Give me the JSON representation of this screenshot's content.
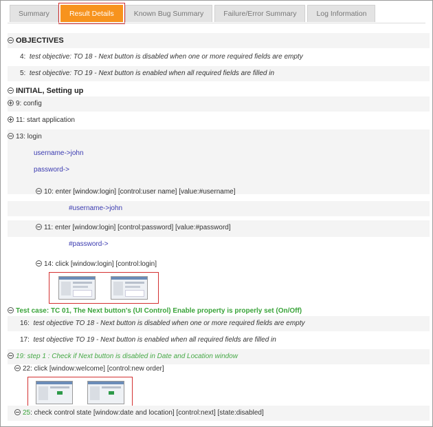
{
  "tabs": [
    "Summary",
    "Result Details",
    "Known Bug Summary",
    "Failure/Error Summary",
    "Log Information"
  ],
  "active_tab": "Result Details",
  "objectives": {
    "title": "OBJECTIVES",
    "items": [
      {
        "num": "4:",
        "text": "test objective: TO 18 - Next button is disabled when one or more required fields are empty"
      },
      {
        "num": "5:",
        "text": "test objective: TO 19 - Next button is enabled when all required fields are filled in"
      }
    ]
  },
  "initial": {
    "title": "INITIAL, Setting up",
    "config": "9: config",
    "start_app": "11: start application",
    "login": "13: login",
    "username": "username->john",
    "password": "password->",
    "enter_user": "10: enter  [window:login] [control:user name] [value:#username]",
    "username_val": "#username->john",
    "enter_pass": "11: enter  [window:login] [control:password] [value:#password]",
    "password_val": "#password->",
    "click_login": "14: click  [window:login] [control:login]"
  },
  "testcase": {
    "title": "Test case: TC 01, The Next button's (UI Control) Enable property is properly set (On/Off)",
    "items": [
      {
        "num": "16:",
        "text": "test objective TO 18 - Next button is disabled when one or more required fields are empty"
      },
      {
        "num": "17:",
        "text": "test objective TO 19 - Next button is enabled when all required fields are filled in"
      }
    ],
    "step": "19: step 1 : Check if Next button is disabled in Date and Location window",
    "click_welcome": "22: click  [window:welcome] [control:new order]",
    "check_num": "25",
    "check_text": ": check control state  [window:date and location] [control:next] [state:disabled]"
  }
}
